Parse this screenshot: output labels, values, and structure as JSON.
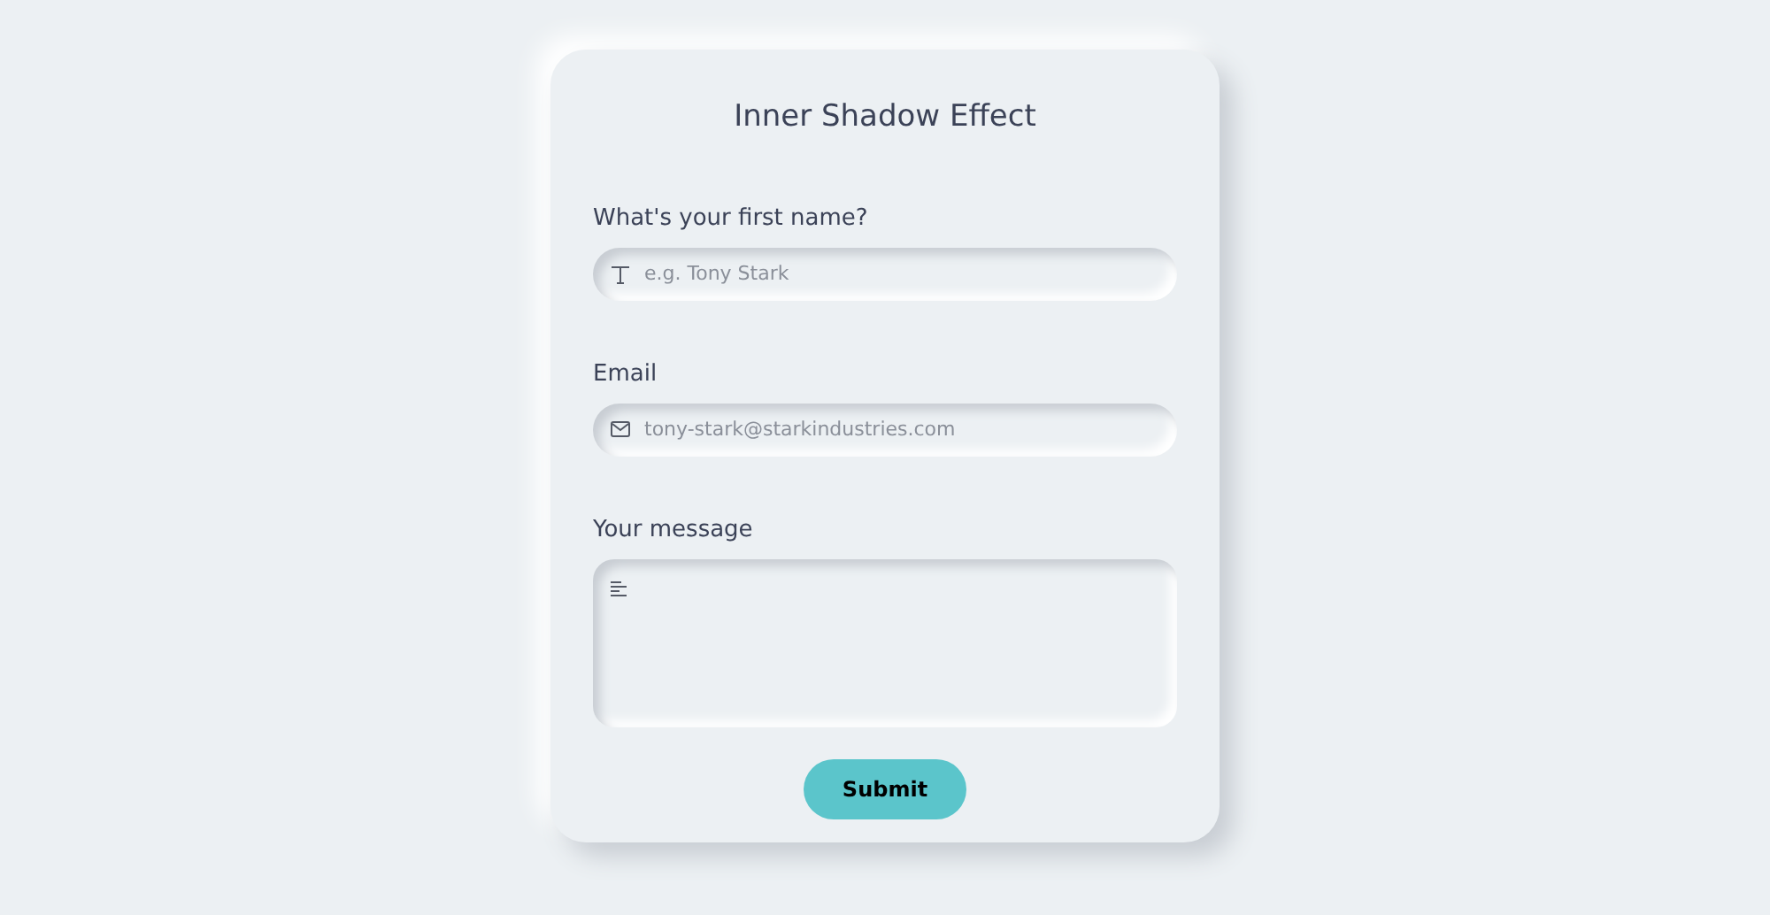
{
  "title": "Inner Shadow Effect",
  "fields": [
    {
      "kind": "text",
      "label": "What's your first name?",
      "placeholder": "e.g. Tony Stark"
    },
    {
      "kind": "email",
      "label": "Email",
      "placeholder": "tony-stark@starkindustries.com"
    },
    {
      "kind": "textarea",
      "label": "Your message"
    }
  ],
  "submit": "Submit"
}
